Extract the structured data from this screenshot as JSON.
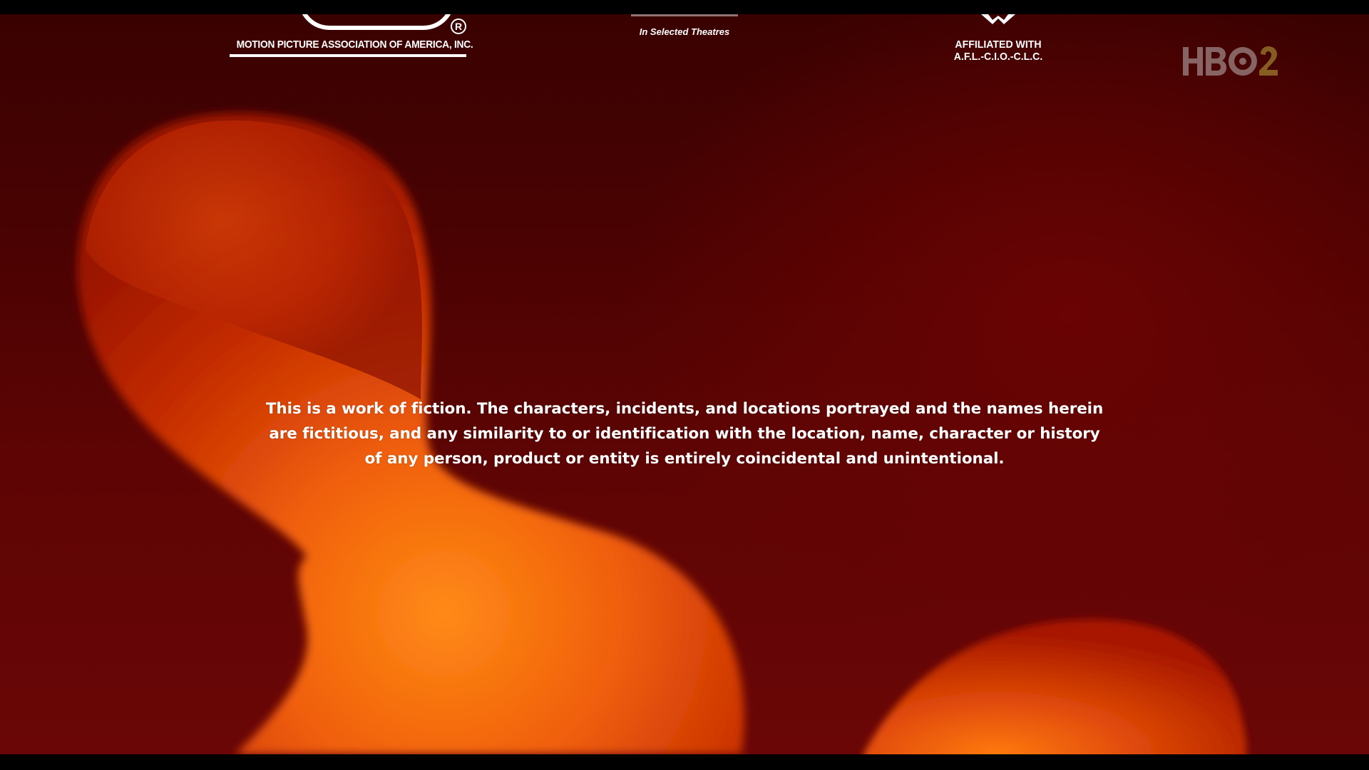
{
  "window": {
    "type": "video-frame",
    "background_color": "#4e0303",
    "blob_colors": [
      "#ff7a10",
      "#e24a06",
      "#b61c02"
    ]
  },
  "logos": {
    "mpaa": {
      "name": "MOTION PICTURE ASSOCIATION OF AMERICA, INC.",
      "registered_mark": "R"
    },
    "theatres": {
      "text": "In Selected Theatres"
    },
    "union": {
      "line1": "AFFILIATED WITH",
      "line2": "A.F.L.-C.I.O.-C.L.C."
    }
  },
  "channel_bug": {
    "icon": "hbo2-logo-icon"
  },
  "disclaimer": {
    "lines": [
      "This is a work of fiction. The characters, incidents, and locations portrayed and the names herein",
      "are fictitious, and any similarity to or identification with the location, name, character or history",
      "of any person, product or entity is entirely coincidental and unintentional."
    ]
  }
}
